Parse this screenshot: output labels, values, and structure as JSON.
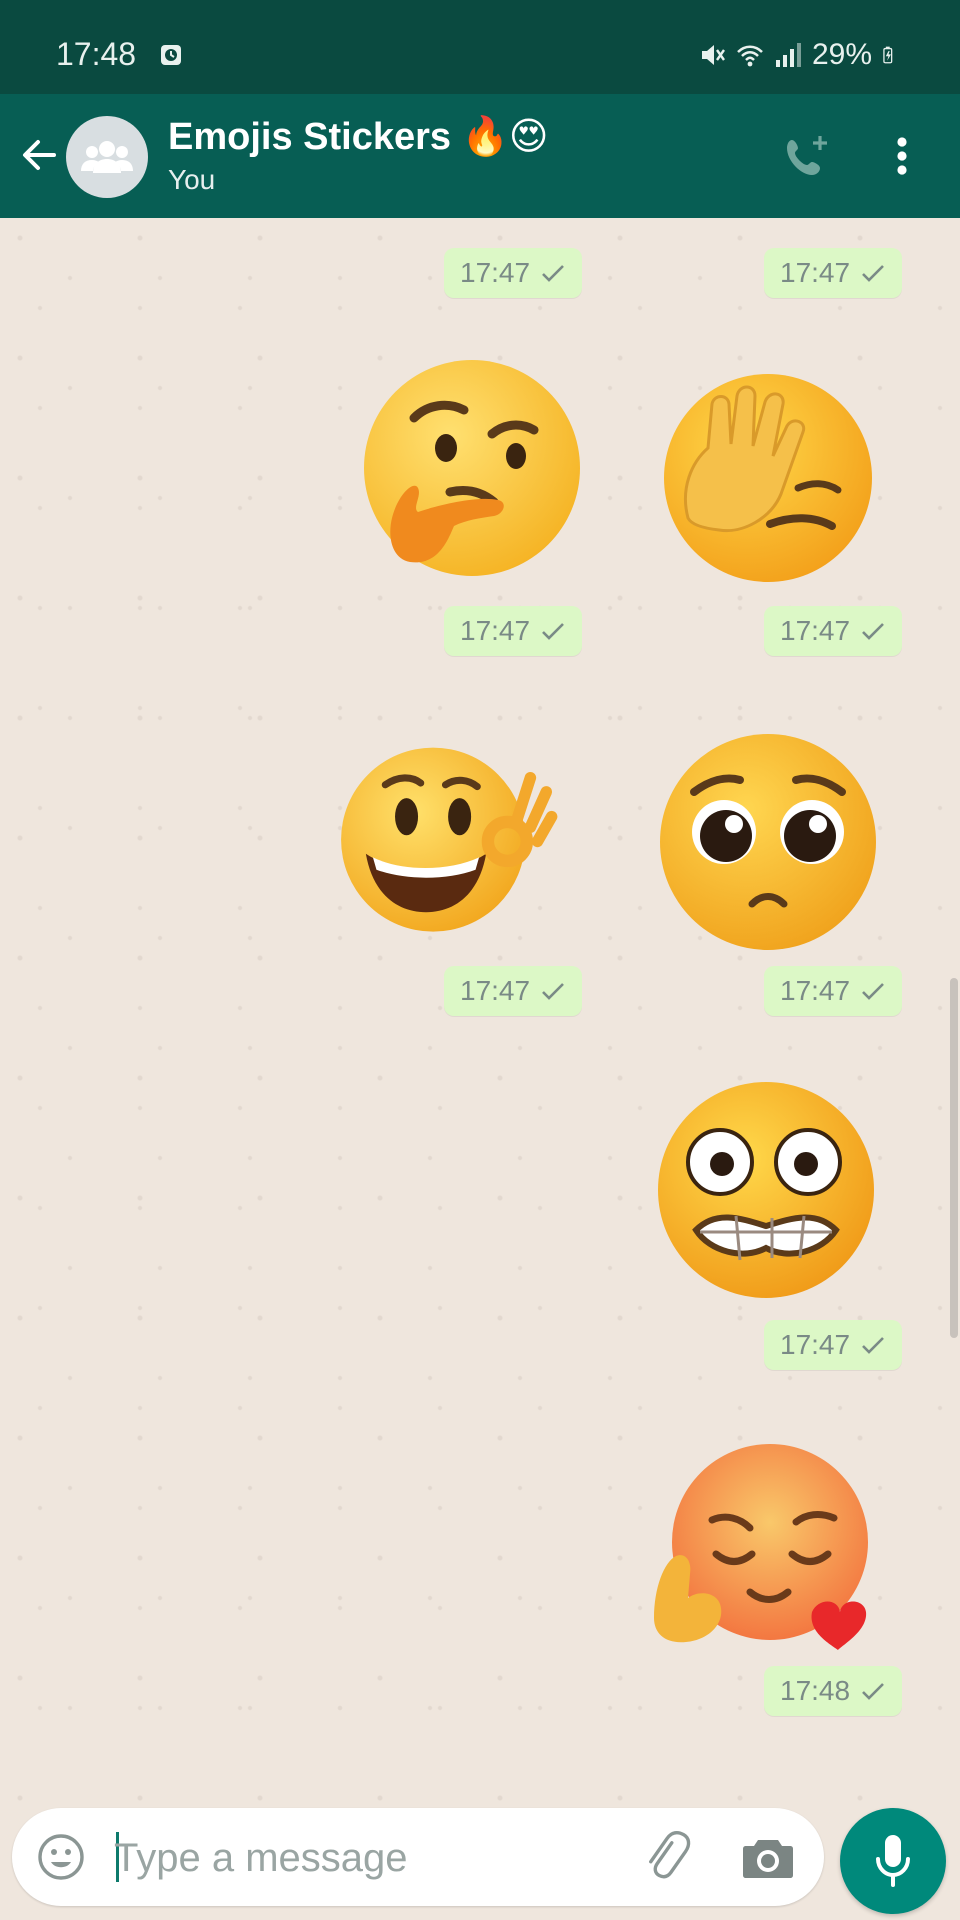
{
  "status_bar": {
    "time": "17:48",
    "battery": "29%"
  },
  "header": {
    "title": "Emojis Stickers 🔥😍",
    "subtitle": "You"
  },
  "messages": [
    {
      "time": "17:47",
      "status": "read-check"
    },
    {
      "time": "17:47",
      "status": "read-check"
    },
    {
      "sticker": "thinking-face",
      "time": "17:47",
      "status": "read-check"
    },
    {
      "sticker": "face-with-hand-over-eyes",
      "time": "17:47",
      "status": "read-check"
    },
    {
      "sticker": "ok-hand-smiley",
      "time": "17:47",
      "status": "read-check"
    },
    {
      "sticker": "pleading-face",
      "time": "17:47",
      "status": "read-check"
    },
    {
      "sticker": "grimacing-wide-eyes-face",
      "time": "17:47",
      "status": "read-check"
    },
    {
      "sticker": "blushing-heart-face",
      "time": "17:48",
      "status": "read-check"
    }
  ],
  "composer": {
    "placeholder": "Type a message"
  },
  "colors": {
    "header": "#075e54",
    "status_bar": "#0a4a40",
    "bubble": "#dcf8c6",
    "accent": "#00897b",
    "chat_bg": "#efe6dd"
  }
}
